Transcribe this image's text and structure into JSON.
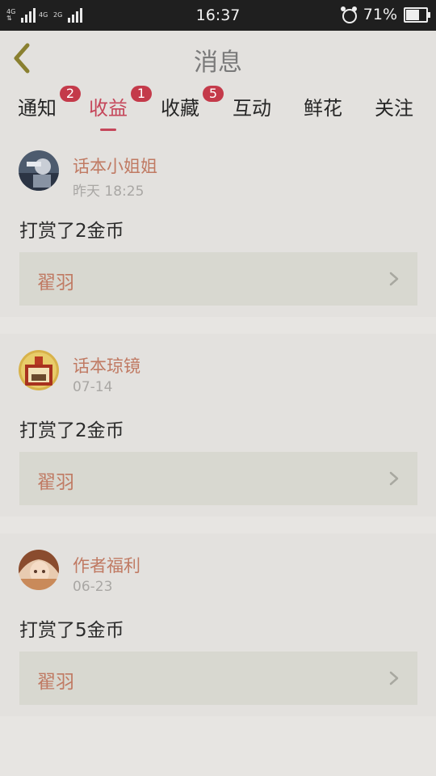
{
  "status_bar": {
    "time": "16:37",
    "battery": "71%",
    "battery_level": 0.71,
    "net1": "4G",
    "net2": "4G",
    "net3": "2G"
  },
  "header": {
    "title": "消息"
  },
  "tabs": [
    {
      "label": "通知",
      "badge": "2"
    },
    {
      "label": "收益",
      "badge": "1",
      "active": true
    },
    {
      "label": "收藏",
      "badge": "5"
    },
    {
      "label": "互动"
    },
    {
      "label": "鲜花"
    },
    {
      "label": "关注"
    }
  ],
  "messages": [
    {
      "sender": "话本小姐姐",
      "time": "昨天 18:25",
      "text": "打赏了2金币",
      "link": "翟羽"
    },
    {
      "sender": "话本琼镜",
      "time": "07-14",
      "text": "打赏了2金币",
      "link": "翟羽"
    },
    {
      "sender": "作者福利",
      "time": "06-23",
      "text": "打赏了5金币",
      "link": "翟羽"
    }
  ],
  "colors": {
    "accent": "#c5465a",
    "badge": "#c43a4a",
    "sender": "#c07a63",
    "back_icon": "#8a8030"
  },
  "icons": {
    "back": "chevron-left-icon",
    "link_arrow": "chevron-right-icon",
    "alarm": "alarm-clock-icon",
    "battery": "battery-icon",
    "signal": "signal-icon"
  }
}
